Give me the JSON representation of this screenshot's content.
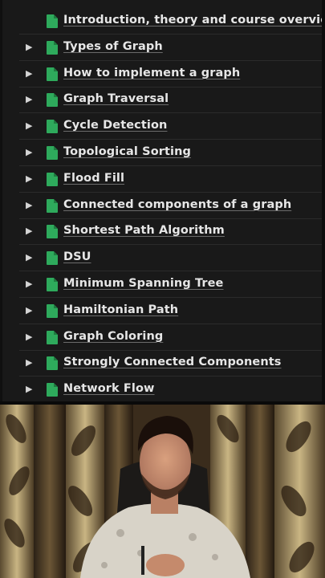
{
  "pages": [
    {
      "label": "Introduction, theory and course overview",
      "toggle": false
    },
    {
      "label": "Types of Graph",
      "toggle": true
    },
    {
      "label": "How to implement a graph",
      "toggle": true
    },
    {
      "label": "Graph Traversal",
      "toggle": true
    },
    {
      "label": "Cycle Detection",
      "toggle": true
    },
    {
      "label": "Topological Sorting",
      "toggle": true
    },
    {
      "label": "Flood Fill",
      "toggle": true
    },
    {
      "label": "Connected components of a graph",
      "toggle": true
    },
    {
      "label": "Shortest Path Algorithm",
      "toggle": true
    },
    {
      "label": "DSU",
      "toggle": true
    },
    {
      "label": "Minimum Spanning Tree",
      "toggle": true
    },
    {
      "label": "Hamiltonian Path",
      "toggle": true
    },
    {
      "label": "Graph Coloring",
      "toggle": true
    },
    {
      "label": "Strongly Connected Components",
      "toggle": true
    },
    {
      "label": "Network Flow",
      "toggle": true
    }
  ],
  "colors": {
    "panel_bg": "#191919",
    "text": "#e6e6e6",
    "doc_icon": "#2eaa5c",
    "divider": "#2b2b2b"
  },
  "icons": {
    "toggle": "triangle-right-icon",
    "page": "green-document-icon"
  }
}
